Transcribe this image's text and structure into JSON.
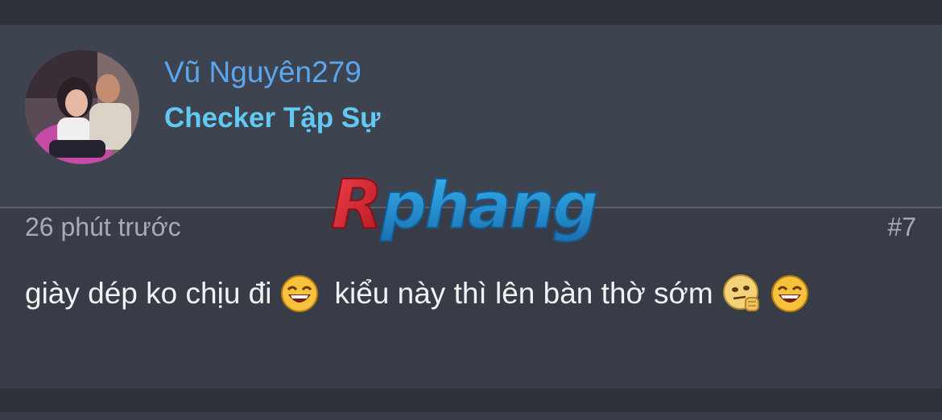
{
  "post": {
    "author": {
      "name": "Vũ Nguyên279",
      "title": "Checker Tập Sự"
    },
    "watermark": "Rphang",
    "time": "26 phút trước",
    "number": "#7",
    "body": {
      "part1": "giày dép ko chịu đi",
      "part2": "kiểu này thì lên bàn thờ sớm"
    },
    "emojis": [
      "laughing-emoji-icon",
      "thinking-emoji-icon",
      "laughing-emoji-icon"
    ]
  },
  "colors": {
    "username": "#5aa7f0",
    "user_title": "#62c9f2",
    "watermark_red": "#d8222f",
    "watermark_blue": "#1f8fd6"
  }
}
